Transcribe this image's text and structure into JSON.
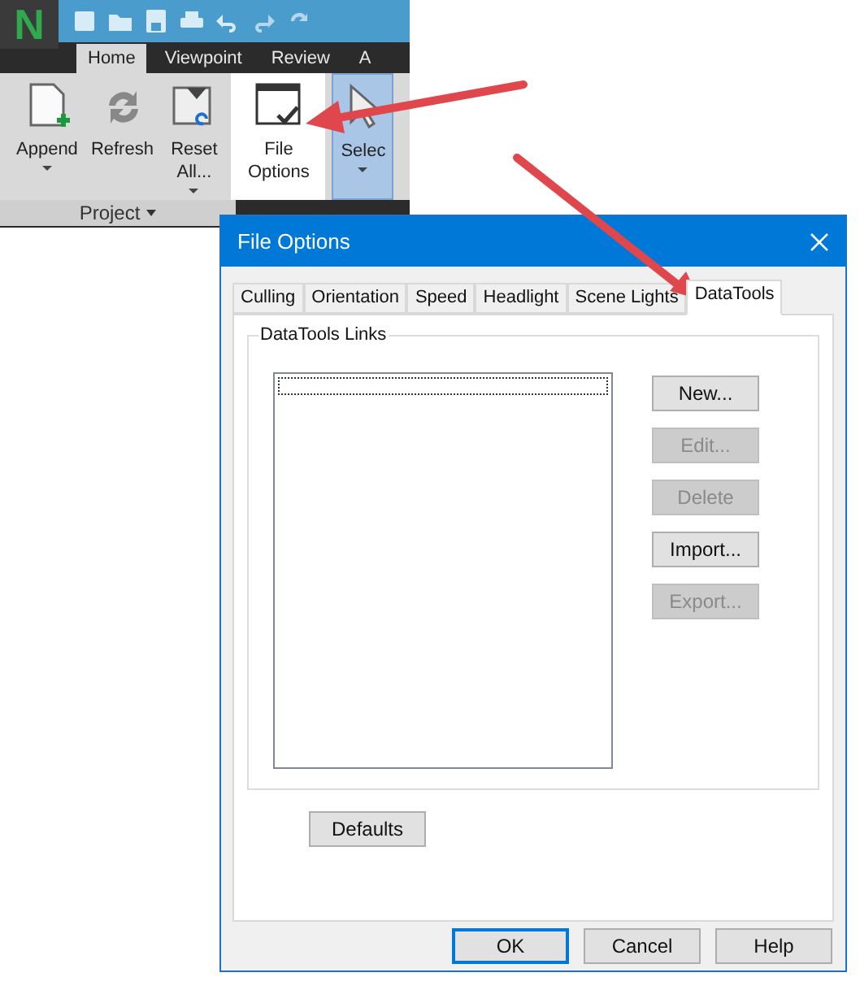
{
  "ribbon": {
    "logo": "N",
    "tabs": [
      {
        "label": "Home",
        "selected": true
      },
      {
        "label": "Viewpoint",
        "selected": false
      },
      {
        "label": "Review",
        "selected": false
      },
      {
        "label": "A",
        "selected": false
      }
    ],
    "buttons": [
      {
        "lines": [
          "Append"
        ],
        "kind": "append",
        "dropdown": true,
        "highlighted": false,
        "selected": false
      },
      {
        "lines": [
          "Refresh"
        ],
        "kind": "refresh",
        "dropdown": false,
        "highlighted": false,
        "selected": false
      },
      {
        "lines": [
          "Reset",
          "All..."
        ],
        "kind": "reset",
        "dropdown": true,
        "highlighted": false,
        "selected": false
      },
      {
        "lines": [
          "File",
          "Options"
        ],
        "kind": "options",
        "dropdown": false,
        "highlighted": true,
        "selected": false
      },
      {
        "lines": [
          "Selec"
        ],
        "kind": "select",
        "dropdown": true,
        "highlighted": false,
        "selected": true
      }
    ],
    "group_label": "Project"
  },
  "dialog": {
    "title": "File Options",
    "tabs": [
      {
        "label": "Culling",
        "selected": false
      },
      {
        "label": "Orientation",
        "selected": false
      },
      {
        "label": "Speed",
        "selected": false
      },
      {
        "label": "Headlight",
        "selected": false
      },
      {
        "label": "Scene Lights",
        "selected": false
      },
      {
        "label": "DataTools",
        "selected": true
      }
    ],
    "group_label": "DataTools Links",
    "side_buttons": [
      {
        "label": "New...",
        "disabled": false
      },
      {
        "label": "Edit...",
        "disabled": true
      },
      {
        "label": "Delete",
        "disabled": true
      },
      {
        "label": "Import...",
        "disabled": false
      },
      {
        "label": "Export...",
        "disabled": true
      }
    ],
    "defaults_button": "Defaults",
    "footer_buttons": [
      {
        "label": "OK",
        "default": true
      },
      {
        "label": "Cancel",
        "default": false
      },
      {
        "label": "Help",
        "default": false
      }
    ]
  }
}
